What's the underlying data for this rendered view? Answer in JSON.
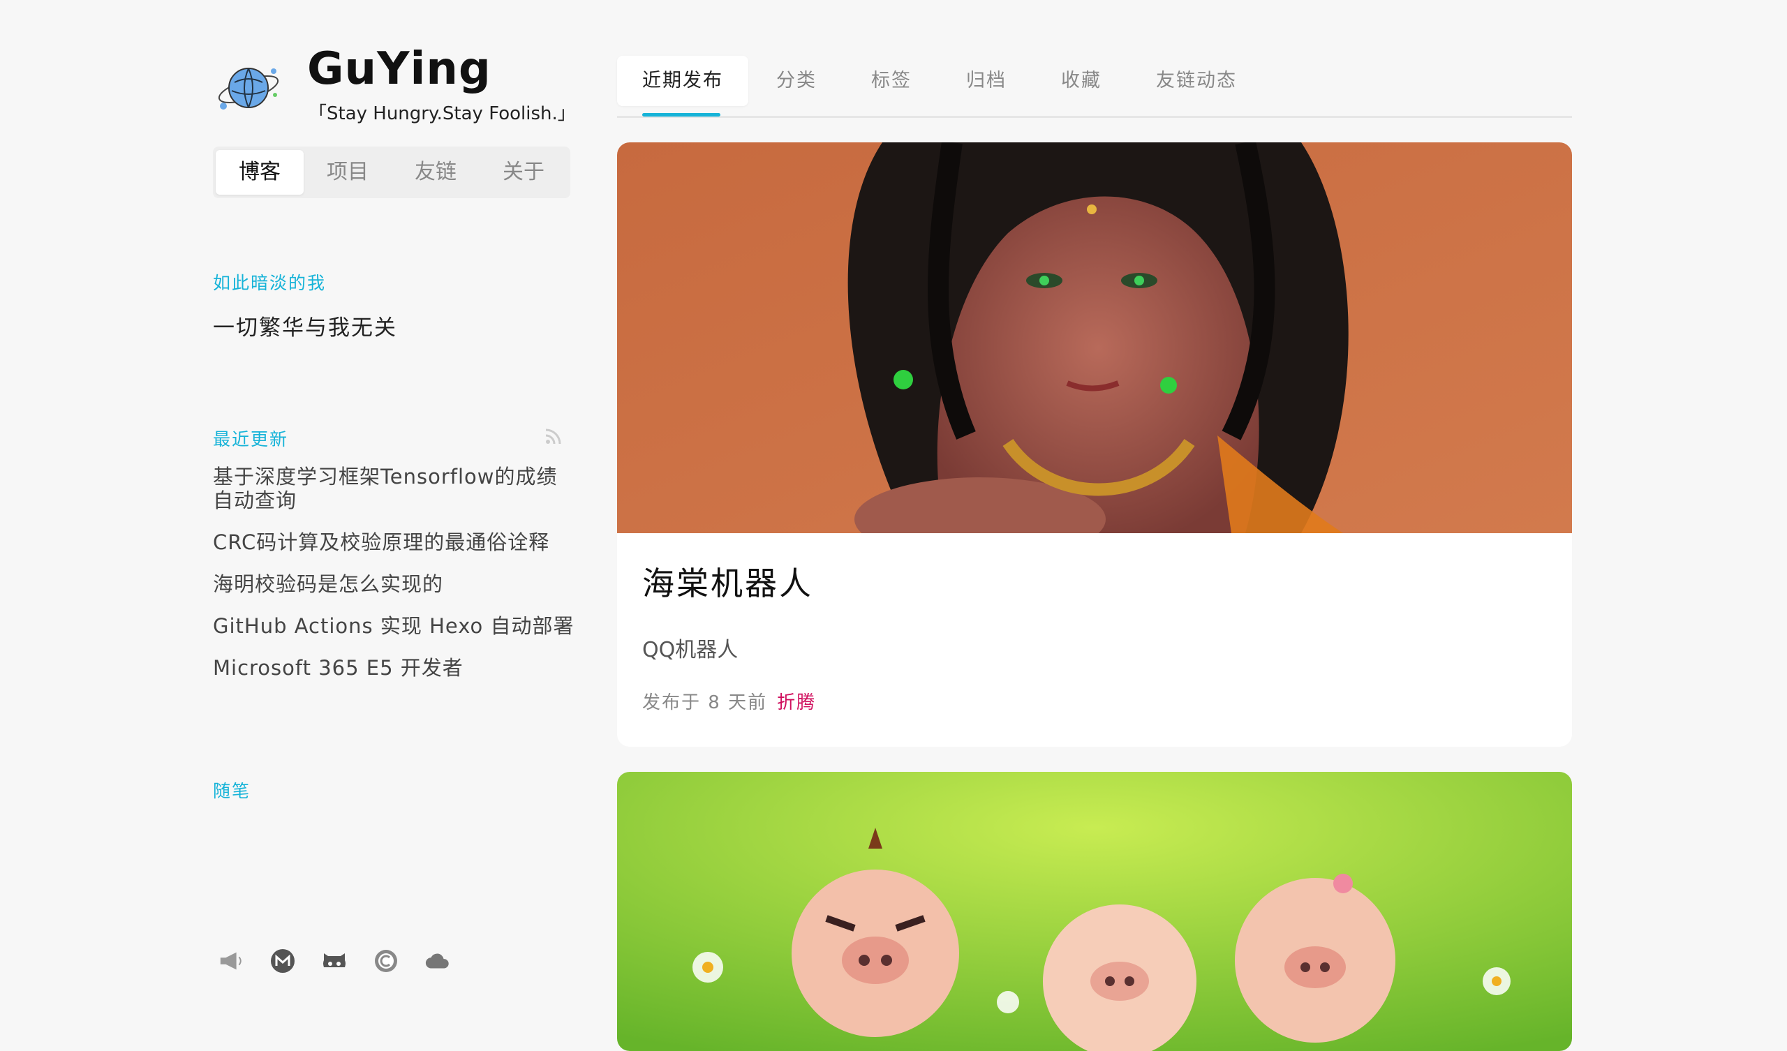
{
  "site": {
    "title": "GuYing",
    "subtitle": "「Stay Hungry.Stay Foolish.」"
  },
  "side_tabs": [
    "博客",
    "项目",
    "友链",
    "关于"
  ],
  "about": {
    "heading": "如此暗淡的我",
    "motto": "一切繁华与我无关"
  },
  "recent": {
    "heading": "最近更新",
    "items": [
      "基于深度学习框架Tensorflow的成绩自动查询",
      "CRC码计算及校验原理的最通俗诠释",
      "海明校验码是怎么实现的",
      "GitHub Actions 实现 Hexo 自动部署",
      "Microsoft 365 E5 开发者"
    ]
  },
  "notes": {
    "heading": "随笔"
  },
  "social_icons": [
    "megaphone-icon",
    "mail-icon",
    "github-icon",
    "copyright-icon",
    "cloud-icon"
  ],
  "nav": [
    "近期发布",
    "分类",
    "标签",
    "归档",
    "收藏",
    "友链动态"
  ],
  "posts": [
    {
      "title": "海棠机器人",
      "description": "QQ机器人",
      "published": "发布于 8 天前",
      "tag": "折腾"
    }
  ],
  "colors": {
    "accent": "#16b3d8",
    "tag": "#d0105e",
    "background": "#f7f7f7"
  }
}
